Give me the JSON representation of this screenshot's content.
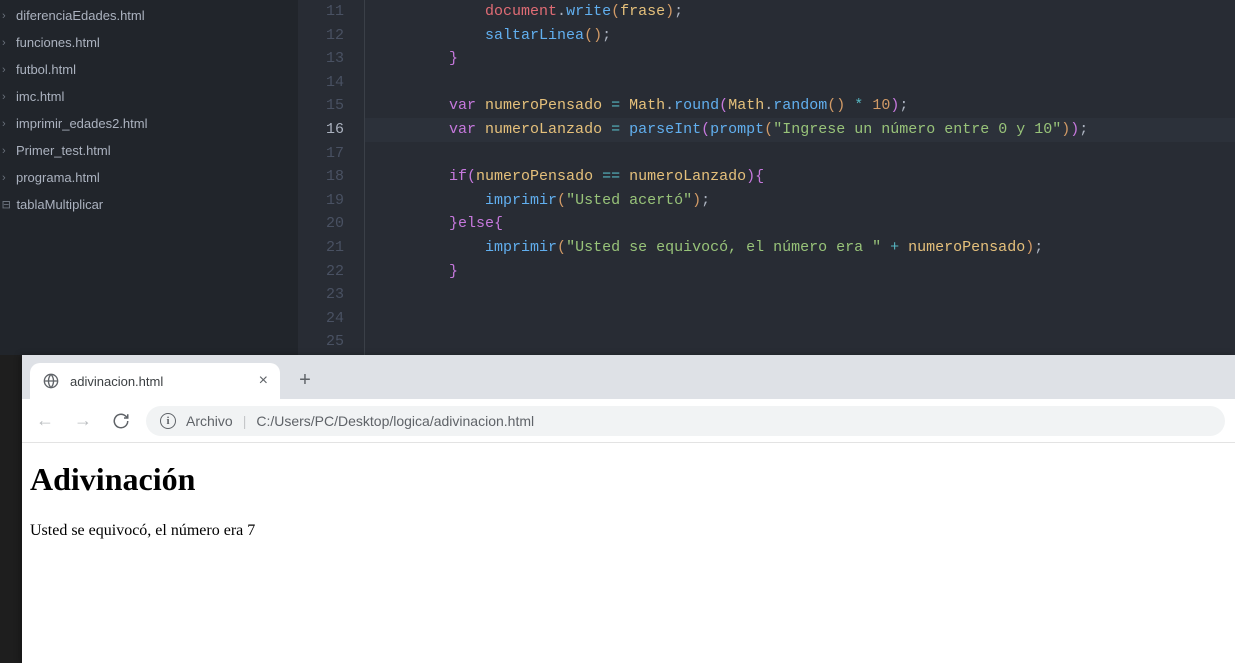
{
  "sidebar": {
    "items": [
      {
        "label": "diferenciaEdades.html",
        "kind": "file"
      },
      {
        "label": "funciones.html",
        "kind": "file"
      },
      {
        "label": "futbol.html",
        "kind": "file"
      },
      {
        "label": "imc.html",
        "kind": "file"
      },
      {
        "label": "imprimir_edades2.html",
        "kind": "file"
      },
      {
        "label": "Primer_test.html",
        "kind": "file"
      },
      {
        "label": "programa.html",
        "kind": "file"
      },
      {
        "label": "tablaMultiplicar",
        "kind": "folder"
      }
    ]
  },
  "editor": {
    "first_line": 11,
    "current_line": 16,
    "lines": [
      {
        "n": 11,
        "indent": 3,
        "tokens": [
          [
            "obj",
            "document"
          ],
          [
            "punc",
            "."
          ],
          [
            "fn",
            "write"
          ],
          [
            "brace-y",
            "("
          ],
          [
            "ident",
            "frase"
          ],
          [
            "brace-y",
            ")"
          ],
          [
            "punc",
            ";"
          ]
        ]
      },
      {
        "n": 12,
        "indent": 3,
        "tokens": [
          [
            "fn",
            "saltarLinea"
          ],
          [
            "brace-y",
            "("
          ],
          [
            "brace-y",
            ")"
          ],
          [
            "punc",
            ";"
          ]
        ]
      },
      {
        "n": 13,
        "indent": 2,
        "tokens": [
          [
            "brace-p",
            "}"
          ]
        ]
      },
      {
        "n": 14,
        "indent": 0,
        "tokens": []
      },
      {
        "n": 15,
        "indent": 2,
        "tokens": [
          [
            "kw",
            "var"
          ],
          [
            "punc",
            " "
          ],
          [
            "ident",
            "numeroPensado"
          ],
          [
            "punc",
            " "
          ],
          [
            "op",
            "="
          ],
          [
            "punc",
            " "
          ],
          [
            "ident",
            "Math"
          ],
          [
            "punc",
            "."
          ],
          [
            "fn",
            "round"
          ],
          [
            "brace-p",
            "("
          ],
          [
            "ident",
            "Math"
          ],
          [
            "punc",
            "."
          ],
          [
            "fn",
            "random"
          ],
          [
            "brace-y",
            "("
          ],
          [
            "brace-y",
            ")"
          ],
          [
            "punc",
            " "
          ],
          [
            "op",
            "*"
          ],
          [
            "punc",
            " "
          ],
          [
            "num",
            "10"
          ],
          [
            "brace-p",
            ")"
          ],
          [
            "punc",
            ";"
          ]
        ]
      },
      {
        "n": 16,
        "indent": 2,
        "hl": true,
        "tokens": [
          [
            "kw",
            "var"
          ],
          [
            "punc",
            " "
          ],
          [
            "ident",
            "numeroLanzado"
          ],
          [
            "punc",
            " "
          ],
          [
            "op",
            "="
          ],
          [
            "punc",
            " "
          ],
          [
            "fn",
            "parseInt"
          ],
          [
            "brace-p",
            "("
          ],
          [
            "fn",
            "prompt"
          ],
          [
            "brace-y",
            "("
          ],
          [
            "str",
            "\"Ingrese un número entre 0 y 10\""
          ],
          [
            "brace-y",
            ")"
          ],
          [
            "brace-p",
            ")"
          ],
          [
            "punc",
            ";"
          ]
        ]
      },
      {
        "n": 17,
        "indent": 0,
        "tokens": []
      },
      {
        "n": 18,
        "indent": 2,
        "tokens": [
          [
            "kw",
            "if"
          ],
          [
            "brace-p",
            "("
          ],
          [
            "ident",
            "numeroPensado"
          ],
          [
            "punc",
            " "
          ],
          [
            "op",
            "=="
          ],
          [
            "punc",
            " "
          ],
          [
            "ident",
            "numeroLanzado"
          ],
          [
            "brace-p",
            ")"
          ],
          [
            "brace-p",
            "{"
          ]
        ]
      },
      {
        "n": 19,
        "indent": 3,
        "tokens": [
          [
            "fn",
            "imprimir"
          ],
          [
            "brace-y",
            "("
          ],
          [
            "str",
            "\"Usted acertó\""
          ],
          [
            "brace-y",
            ")"
          ],
          [
            "punc",
            ";"
          ]
        ]
      },
      {
        "n": 20,
        "indent": 2,
        "tokens": [
          [
            "brace-p",
            "}"
          ],
          [
            "kw",
            "else"
          ],
          [
            "brace-p",
            "{"
          ]
        ]
      },
      {
        "n": 21,
        "indent": 3,
        "tokens": [
          [
            "fn",
            "imprimir"
          ],
          [
            "brace-y",
            "("
          ],
          [
            "str",
            "\"Usted se equivocó, el número era \""
          ],
          [
            "punc",
            " "
          ],
          [
            "op",
            "+"
          ],
          [
            "punc",
            " "
          ],
          [
            "ident",
            "numeroPensado"
          ],
          [
            "brace-y",
            ")"
          ],
          [
            "punc",
            ";"
          ]
        ]
      },
      {
        "n": 22,
        "indent": 2,
        "tokens": [
          [
            "brace-p",
            "}"
          ]
        ]
      },
      {
        "n": 23,
        "indent": 0,
        "tokens": []
      },
      {
        "n": 24,
        "indent": 0,
        "tokens": []
      },
      {
        "n": 25,
        "indent": 0,
        "tokens": []
      }
    ]
  },
  "browser": {
    "tab_title": "adivinacion.html",
    "url_prefix": "Archivo",
    "url_path": "C:/Users/PC/Desktop/logica/adivinacion.html",
    "page_heading": "Adivinación",
    "page_text": "Usted se equivocó, el número era 7"
  }
}
